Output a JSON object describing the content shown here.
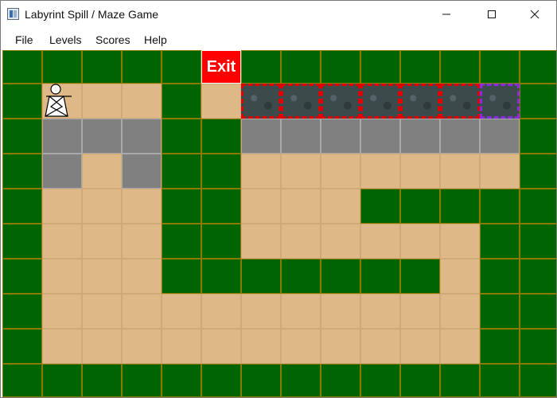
{
  "window": {
    "title": "Labyrint Spill / Maze Game",
    "icon": "app-icon",
    "buttons": [
      "minimize-icon",
      "maximize-icon",
      "close-icon"
    ]
  },
  "menu": {
    "items": [
      "File",
      "Levels",
      "Scores",
      "Help"
    ]
  },
  "board": {
    "exit_label": "Exit",
    "colors": {
      "wall": "#006400",
      "path": "#deb887",
      "stone": "#808080",
      "exit": "#ff0000",
      "tile_border": "#e00000",
      "special_tile_border": "#8a2be2"
    },
    "legend": {
      "W": "wall",
      "P": "path",
      "S": "stone",
      "E": "exit",
      "T": "tile",
      "V": "special-tile"
    },
    "grid": [
      "WWWWWEWWWWWWWW",
      "WPPPWPTTTTTTVW",
      "WSSSWWSSSSSSSW",
      "WSPSWWPPPPPPPW",
      "WPPPWWPPPWWWWW",
      "WPPPWWPPPPPPWW",
      "WPPPWWWWWWWPWW",
      "WPPPPPPPPPPPWW",
      "WPPPPPPPPPPPWW",
      "WWWWWWWWWWWWWW"
    ],
    "player_icon": "player-icon"
  }
}
